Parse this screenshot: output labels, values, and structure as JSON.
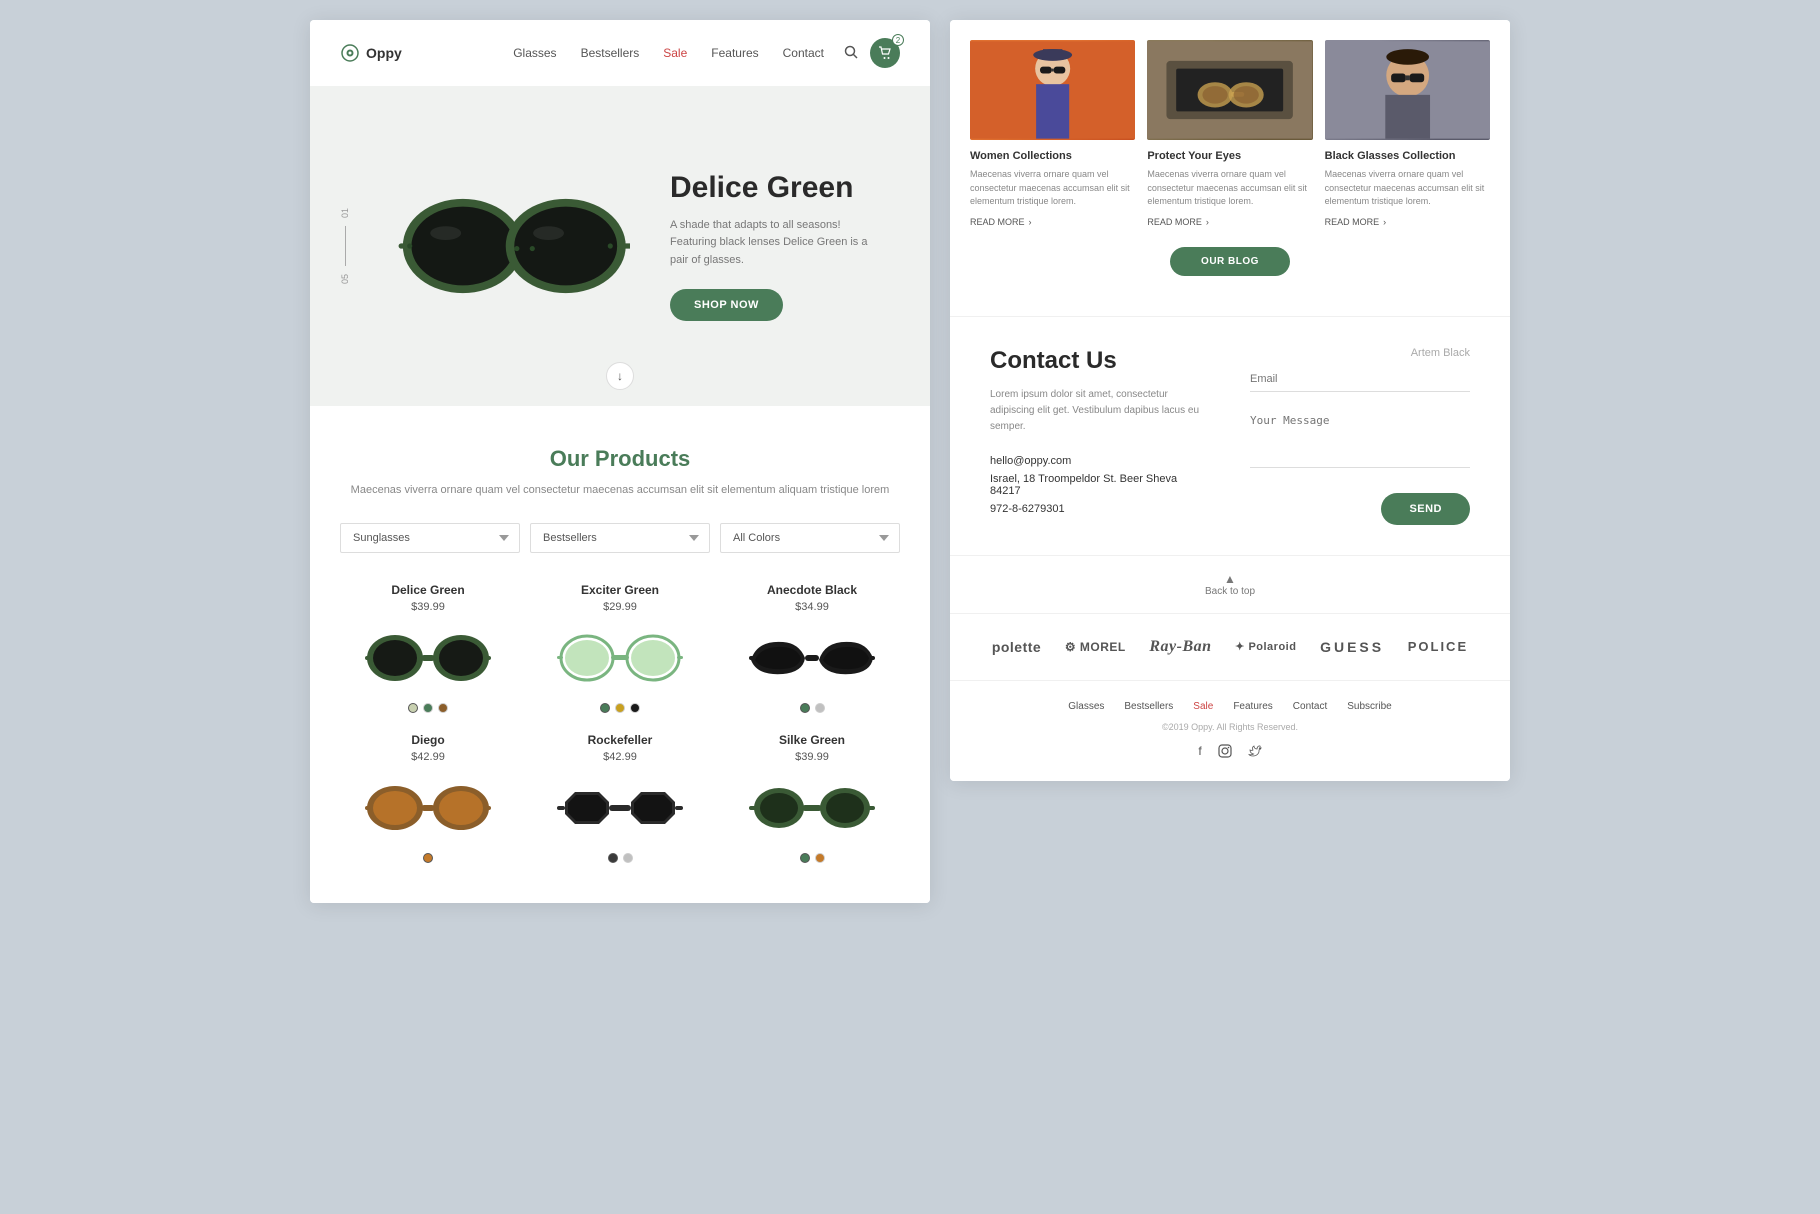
{
  "leftPanel": {
    "nav": {
      "logo": "Oppy",
      "links": [
        {
          "label": "Glasses",
          "id": "glasses",
          "sale": false
        },
        {
          "label": "Bestsellers",
          "id": "bestsellers",
          "sale": false
        },
        {
          "label": "Sale",
          "id": "sale",
          "sale": true
        },
        {
          "label": "Features",
          "id": "features",
          "sale": false
        },
        {
          "label": "Contact",
          "id": "contact",
          "sale": false
        }
      ],
      "cartCount": "2"
    },
    "hero": {
      "title": "Delice Green",
      "description": "A shade that adapts to all seasons! Featuring black lenses Delice Green is a pair of glasses.",
      "shopNowLabel": "SHOP NOW",
      "scrollDownLabel": "↓"
    },
    "products": {
      "title": "Our Products",
      "subtitle": "Maecenas viverra ornare quam vel consectetur maecenas accumsan elit sit\nelementum aliquam tristique lorem",
      "filters": [
        {
          "label": "Sunglasses",
          "value": "sunglasses"
        },
        {
          "label": "Bestsellers",
          "value": "bestsellers"
        },
        {
          "label": "All Colors",
          "value": "all-colors"
        }
      ],
      "items": [
        {
          "name": "Delice Green",
          "price": "$39.99",
          "colors": [
            "#c8d0b0",
            "#4a7c59",
            "#8b5e2a"
          ],
          "type": "round-green"
        },
        {
          "name": "Exciter Green",
          "price": "$29.99",
          "colors": [
            "#4a7c59",
            "#c8a020",
            "#1a1a1a"
          ],
          "type": "round-light-green"
        },
        {
          "name": "Anecdote Black",
          "price": "$34.99",
          "colors": [
            "#4a7c59",
            "#c0c0c0"
          ],
          "type": "cat-black"
        },
        {
          "name": "Diego",
          "price": "$42.99",
          "colors": [
            "#c47a2a"
          ],
          "type": "round-amber"
        },
        {
          "name": "Rockefeller",
          "price": "$42.99",
          "colors": [
            "#3a3a3a",
            "#c0c0c0"
          ],
          "type": "round-dark"
        },
        {
          "name": "Silke Green",
          "price": "$39.99",
          "colors": [
            "#4a7c59",
            "#c47a2a"
          ],
          "type": "round-green-small"
        }
      ]
    }
  },
  "rightPanel": {
    "blog": {
      "cards": [
        {
          "title": "Women Collections",
          "text": "Maecenas viverra ornare quam vel consectetur maecenas accumsan elit sit elementum tristique lorem.",
          "readMore": "READ MORE"
        },
        {
          "title": "Protect Your Eyes",
          "text": "Maecenas viverra ornare quam vel consectetur maecenas accumsan elit sit elementum tristique lorem.",
          "readMore": "READ MORE"
        },
        {
          "title": "Black Glasses Collection",
          "text": "Maecenas viverra ornare quam vel consectetur maecenas accumsan elit sit elementum tristique lorem.",
          "readMore": "READ MORE"
        }
      ],
      "ourBlogLabel": "OUR BLOG"
    },
    "contact": {
      "title": "Contact Us",
      "description": "Lorem ipsum dolor sit amet, consectetur adipiscing elit get. Vestibulum dapibus lacus eu semper.",
      "email": "hello@oppy.com",
      "address": "Israel, 18 Troompeldor St. Beer Sheva 84217",
      "phone": "972-8-6279301",
      "namePlaceholder": "Artem Black",
      "emailPlaceholder": "Email",
      "messagePlaceholder": "Your Message",
      "sendLabel": "SEND"
    },
    "backToTop": "Back to top",
    "brands": [
      "polette",
      "MOREL",
      "Ray-Ban",
      "Polaroid",
      "GUESS",
      "POLICE"
    ],
    "footer": {
      "links": [
        {
          "label": "Glasses",
          "sale": false
        },
        {
          "label": "Bestsellers",
          "sale": false
        },
        {
          "label": "Sale",
          "sale": true
        },
        {
          "label": "Features",
          "sale": false
        },
        {
          "label": "Contact",
          "sale": false
        },
        {
          "label": "Subscribe",
          "sale": false
        }
      ],
      "copyright": "©2019 Oppy. All Rights Reserved.",
      "social": [
        "f",
        "🔷",
        "🐦"
      ]
    }
  }
}
